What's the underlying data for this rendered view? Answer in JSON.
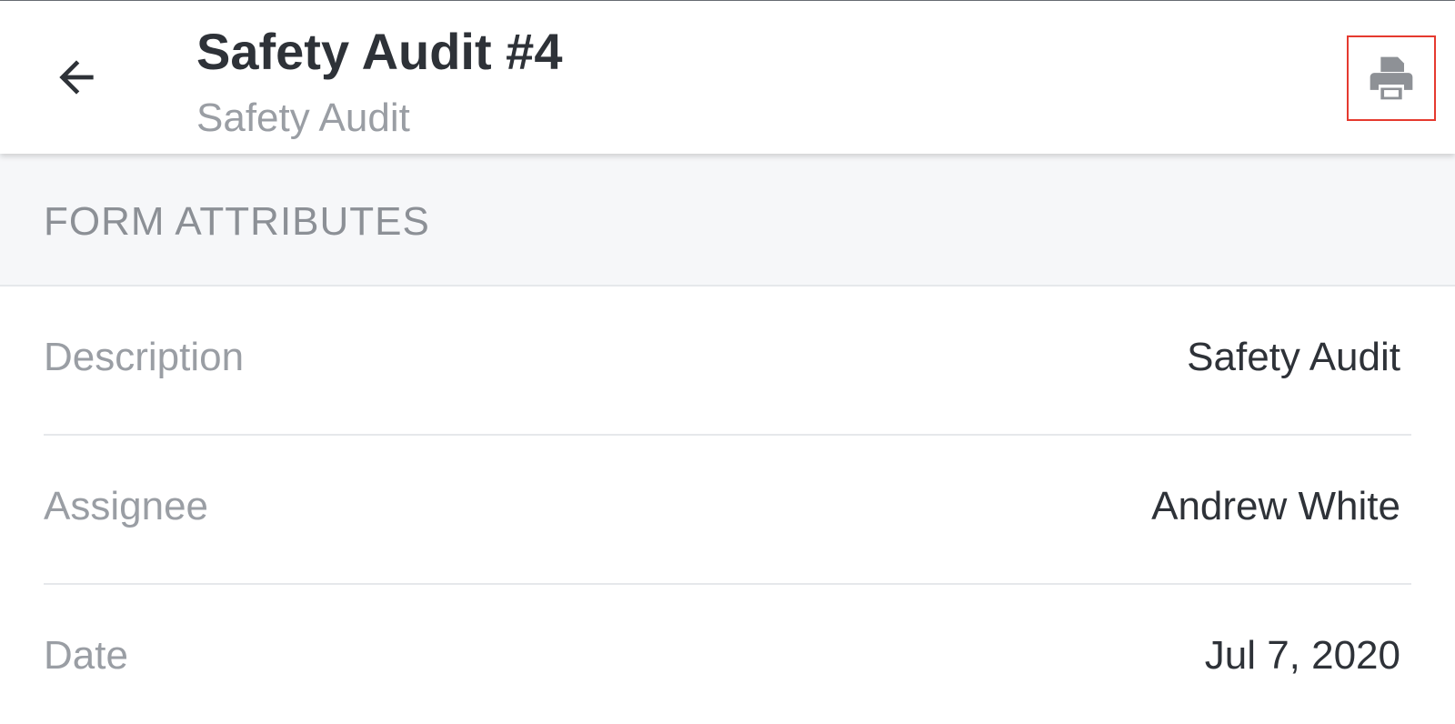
{
  "header": {
    "title": "Safety Audit #4",
    "subtitle": "Safety Audit",
    "back_icon": "arrow-left-icon",
    "print_icon": "printer-icon"
  },
  "section": {
    "title": "FORM ATTRIBUTES"
  },
  "attributes": [
    {
      "label": "Description",
      "value": "Safety Audit"
    },
    {
      "label": "Assignee",
      "value": "Andrew White"
    },
    {
      "label": "Date",
      "value": "Jul 7, 2020"
    }
  ],
  "colors": {
    "text_primary": "#2e3238",
    "text_secondary": "#9a9ea4",
    "section_bg": "#f6f7f9",
    "highlight_border": "#e53a2f",
    "icon_gray": "#8e9196"
  }
}
